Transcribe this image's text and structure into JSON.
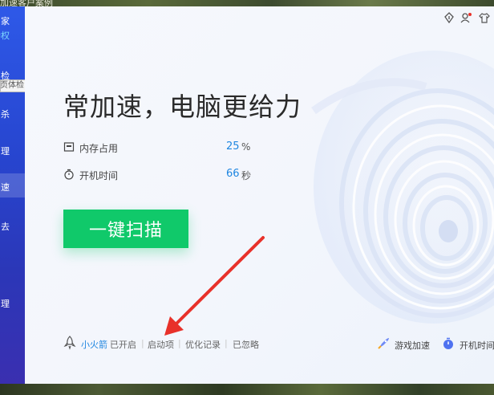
{
  "desktop": {
    "title_fragment": "加速客户案例"
  },
  "sidebar": {
    "items": [
      {
        "label": "家"
      },
      {
        "label": "特权"
      },
      {
        "label": "检"
      },
      {
        "label": "杀"
      },
      {
        "label": "理"
      },
      {
        "label": "速"
      },
      {
        "label": "去"
      },
      {
        "label": "理"
      }
    ],
    "tooltip": "首页体检"
  },
  "header_icons": [
    "skin-icon",
    "user-icon",
    "shirt-icon"
  ],
  "main": {
    "headline": "常加速，电脑更给力",
    "stats": [
      {
        "icon": "memory-icon",
        "label": "内存占用",
        "value": "25",
        "unit": "%"
      },
      {
        "icon": "timer-icon",
        "label": "开机时间",
        "value": "66",
        "unit": "秒"
      }
    ],
    "scan_button": "一键扫描"
  },
  "bottom_bar": {
    "rocket_label": "小火箭",
    "rocket_status": "已开启",
    "sep": "|",
    "startup": "启动项",
    "history": "优化记录",
    "ignored": "已忽略"
  },
  "bottom_right": {
    "game_boost": "游戏加速",
    "boot_time": "开机时间"
  },
  "colors": {
    "accent_blue": "#1f86e0",
    "scan_green": "#10c96a",
    "sidebar_blue": "#2745cf",
    "arrow_red": "#e8312a"
  }
}
